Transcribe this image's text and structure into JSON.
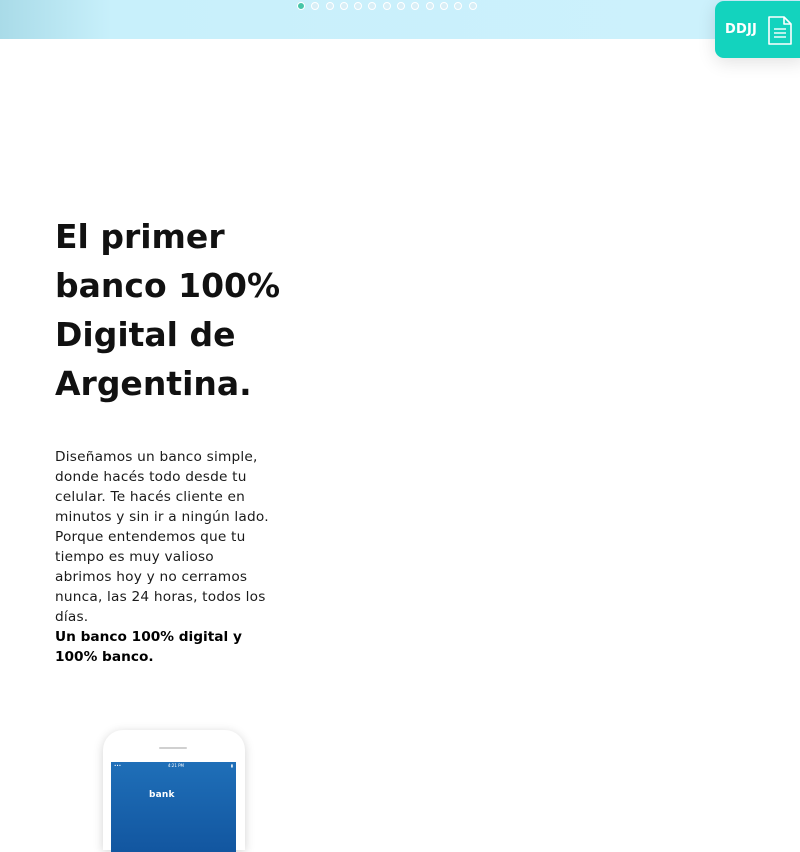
{
  "carousel": {
    "slide_count": 13,
    "active_index": 0
  },
  "ddjj_button": {
    "label": "DDJJ",
    "icon": "document-icon",
    "color": "#13d3be"
  },
  "hero": {
    "headline": "El primer banco 100% Digital de Argentina.",
    "body": "Diseñamos un banco simple, donde hacés todo desde tu celular. Te hacés cliente en minutos y sin ir a ningún lado. Porque entendemos que tu tiempo es muy valioso abrimos hoy y no cerramos nunca, las 24 horas, todos los días.",
    "tagline": "Un banco 100% digital y 100% banco."
  },
  "phone_mockup": {
    "logo_text": "bank",
    "time": "4:21 PM"
  },
  "colors": {
    "accent": "#13d3be",
    "active_dot": "#46c5a7",
    "strip": "#cdf1fc"
  }
}
